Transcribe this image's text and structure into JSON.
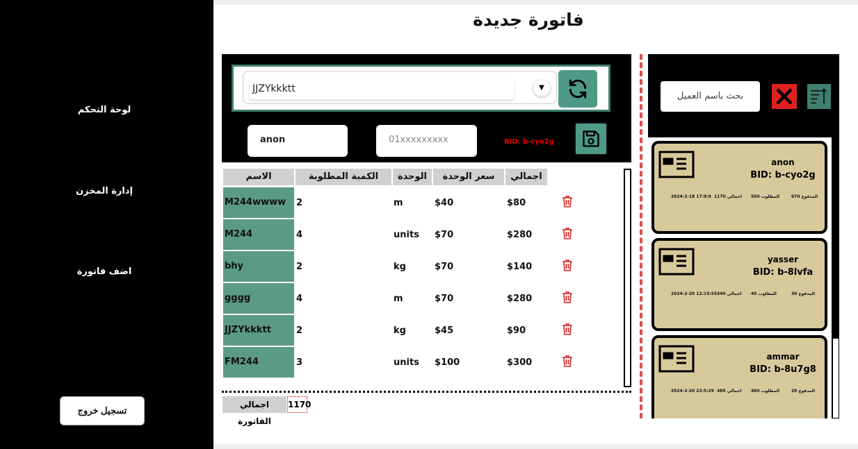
{
  "sidebar": {
    "items": [
      {
        "label": "لوحة التحكم"
      },
      {
        "label": "إدارة المخزن"
      },
      {
        "label": "اضف فاتورة"
      }
    ],
    "logout_label": "تسجيل خروج"
  },
  "page": {
    "title": "فاتورة جديدة"
  },
  "form": {
    "product_value": "JJZYkkktt",
    "customer_name": "anon",
    "phone_placeholder": "01xxxxxxxxx",
    "bid": "BID: b-cyo2g"
  },
  "table": {
    "headers": {
      "name": "الاسم",
      "qty": "الكمبة المطلوبة",
      "unit": "الوحدة",
      "price": "سعر الوحدة",
      "total": "اجمالي"
    },
    "rows": [
      {
        "name": "M244wwww",
        "qty": "2",
        "unit": "m",
        "price": "$40",
        "total": "$80"
      },
      {
        "name": "M244",
        "qty": "4",
        "unit": "units",
        "price": "$70",
        "total": "$280"
      },
      {
        "name": "bhy",
        "qty": "2",
        "unit": "kg",
        "price": "$70",
        "total": "$140"
      },
      {
        "name": "gggg",
        "qty": "4",
        "unit": "m",
        "price": "$70",
        "total": "$280"
      },
      {
        "name": "JJZYkkktt",
        "qty": "2",
        "unit": "kg",
        "price": "$45",
        "total": "$90"
      },
      {
        "name": "FM244",
        "qty": "3",
        "unit": "units",
        "price": "$100",
        "total": "$300"
      }
    ]
  },
  "summary": {
    "total_label": "اجمالي الفاتورة",
    "total_value": "1170"
  },
  "invoices": {
    "search_placeholder": "بحث باسم العميل",
    "cards": [
      {
        "name": "anon",
        "bid": "BID: b-cyo2g",
        "paid": "المدفوع 670",
        "required": "المطلوب 500",
        "total": "اجمالي 1170",
        "date": "2024-2-18 17:9:9"
      },
      {
        "name": "yasser",
        "bid": "BID: b-8lvfa",
        "paid": "المدفوع 30",
        "required": "المطلوب 40",
        "total": "اجمالي 340",
        "date": "2024-2-20 12:15:55"
      },
      {
        "name": "ammar",
        "bid": "BID: b-8u7g8",
        "paid": "المدفوع 20",
        "required": "المطلوب 460",
        "total": "اجمالي 480",
        "date": "2024-2-20 23:5:29"
      }
    ]
  },
  "colors": {
    "accent": "#4e9a86",
    "danger": "#e02020",
    "card": "#d8c99c",
    "sidebar": "#000000"
  }
}
